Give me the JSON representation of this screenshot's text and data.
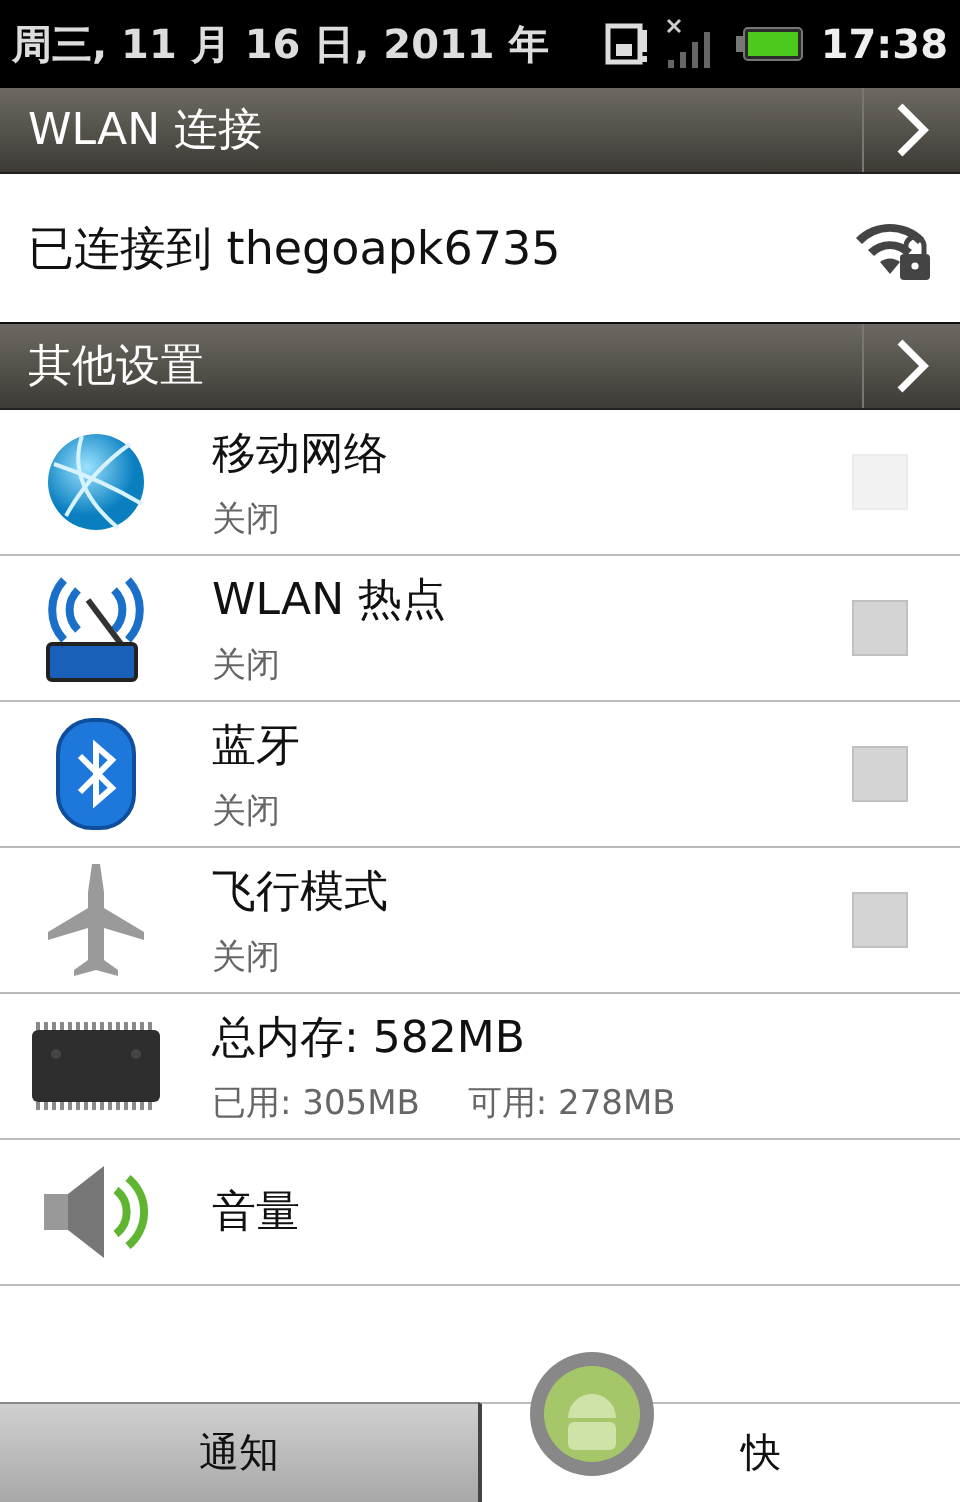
{
  "status_bar": {
    "date": "周三, 11 月 16 日, 2011 年",
    "time": "17:38"
  },
  "wlan_section": {
    "title": "WLAN 连接",
    "status": "已连接到 thegoapk6735"
  },
  "other_section": {
    "title": "其他设置"
  },
  "items": [
    {
      "kind": "toggle",
      "title": "移动网络",
      "subtitle": "关闭",
      "checked": false,
      "disabled": true
    },
    {
      "kind": "toggle",
      "title": "WLAN 热点",
      "subtitle": "关闭",
      "checked": false,
      "disabled": false
    },
    {
      "kind": "toggle",
      "title": "蓝牙",
      "subtitle": "关闭",
      "checked": false,
      "disabled": false
    },
    {
      "kind": "toggle",
      "title": "飞行模式",
      "subtitle": "关闭",
      "checked": false,
      "disabled": false
    },
    {
      "kind": "memory",
      "title": "总内存: 582MB",
      "used": "已用: 305MB",
      "free": "可用: 278MB"
    },
    {
      "kind": "volume",
      "title": "音量"
    }
  ],
  "tabs": [
    {
      "label": "通知",
      "selected": false
    },
    {
      "label": "快",
      "selected": true
    }
  ]
}
